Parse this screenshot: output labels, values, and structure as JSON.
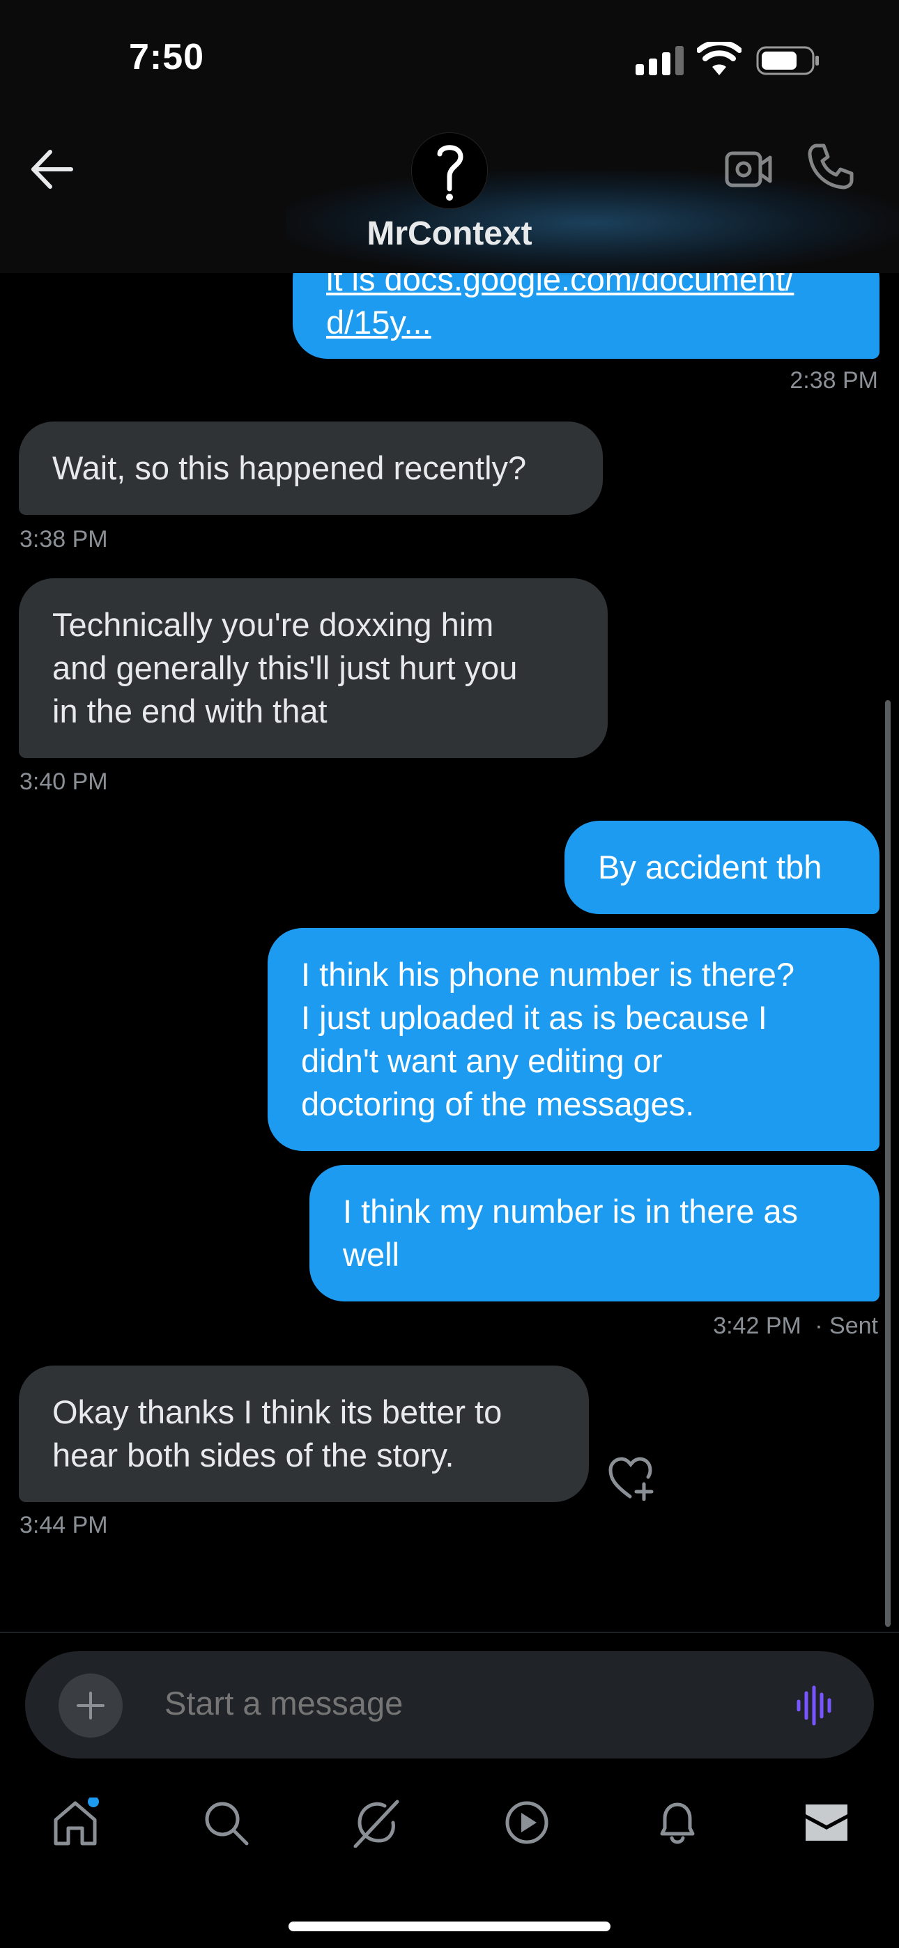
{
  "status_bar": {
    "time": "7:50"
  },
  "header": {
    "contact_name": "MrContext"
  },
  "messages": [
    {
      "direction": "outgoing",
      "lines": [
        "it is docs.google.com/document/",
        "d/15y..."
      ],
      "time": "2:38 PM"
    },
    {
      "direction": "incoming",
      "lines": [
        "Wait, so this happened recently?"
      ],
      "time": "3:38 PM"
    },
    {
      "direction": "incoming",
      "lines": [
        "Technically you're doxxing him",
        "and generally this'll just hurt you",
        "in the end with that"
      ],
      "time": "3:40 PM"
    },
    {
      "direction": "outgoing",
      "lines": [
        "By accident tbh"
      ]
    },
    {
      "direction": "outgoing",
      "lines": [
        "I think his phone number is there?",
        "I just uploaded it as is because I",
        "didn't want any editing or",
        "doctoring of the messages."
      ]
    },
    {
      "direction": "outgoing",
      "lines": [
        "I think my number is in there as",
        "well"
      ],
      "time": "3:42 PM",
      "status": "· Sent"
    },
    {
      "direction": "incoming",
      "lines": [
        "Okay thanks I think its better to",
        "hear both sides of the story."
      ],
      "time": "3:44 PM"
    }
  ],
  "composer": {
    "placeholder": "Start a message"
  },
  "bottom_nav": [
    {
      "icon": "home-icon",
      "has_badge": true
    },
    {
      "icon": "search-icon"
    },
    {
      "icon": "grok-icon"
    },
    {
      "icon": "video-play-icon"
    },
    {
      "icon": "notifications-bell-icon"
    },
    {
      "icon": "messages-envelope-icon",
      "active": true
    }
  ],
  "colors": {
    "background": "#000000",
    "outgoing_bubble": "#1d9bf0",
    "incoming_bubble": "#2f3336",
    "timestamp": "#8b9096",
    "voice_accent": "#7856ff",
    "badge": "#1d9bf0"
  }
}
